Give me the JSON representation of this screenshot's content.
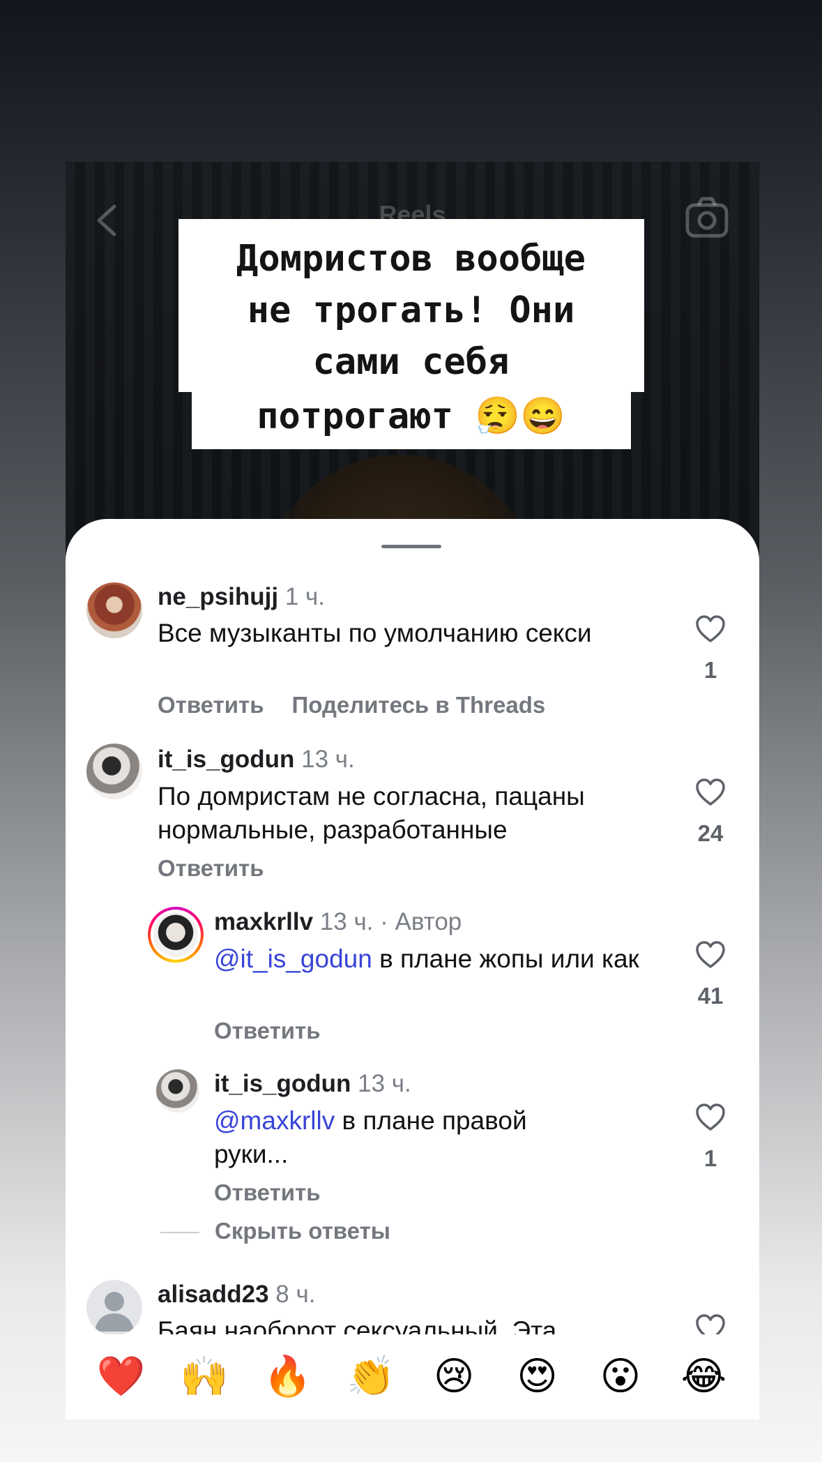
{
  "reels_header": {
    "title": "Reels"
  },
  "caption": {
    "lines": [
      "Домристов вообще",
      "не трогать! Они",
      "сами себя"
    ],
    "last_line": "потрогают 😮‍💨😄"
  },
  "comments": [
    {
      "username": "ne_psihujj",
      "time": "1 ч.",
      "text": "Все музыканты по умолчанию секси",
      "actions": [
        "Ответить",
        "Поделитесь в Threads"
      ],
      "likes": "1"
    },
    {
      "username": "it_is_godun",
      "time": "13 ч.",
      "text": "По домристам не согласна, пацаны нормальные, разработанные",
      "actions": [
        "Ответить"
      ],
      "likes": "24"
    },
    {
      "username": "maxkrllv",
      "time": "13 ч. · Автор",
      "mention": "@it_is_godun",
      "text": " в плане жопы или как",
      "actions": [
        "Ответить"
      ],
      "likes": "41"
    },
    {
      "username": "it_is_godun",
      "time": "13 ч.",
      "mention": "@maxkrllv",
      "text": " в плане правой руки...",
      "actions": [
        "Ответить"
      ],
      "likes": "1"
    },
    {
      "username": "alisadd23",
      "time": "8 ч.",
      "text": "Баян наоборот сексуальный. Эта"
    }
  ],
  "hide_replies": "Скрыть ответы",
  "emoji_bar": [
    "❤️",
    "🙌",
    "🔥",
    "👏",
    "😢",
    "😍",
    "😮",
    "😂"
  ],
  "colors": {
    "mention": "#3844d8",
    "action_grey": "#74787e"
  }
}
